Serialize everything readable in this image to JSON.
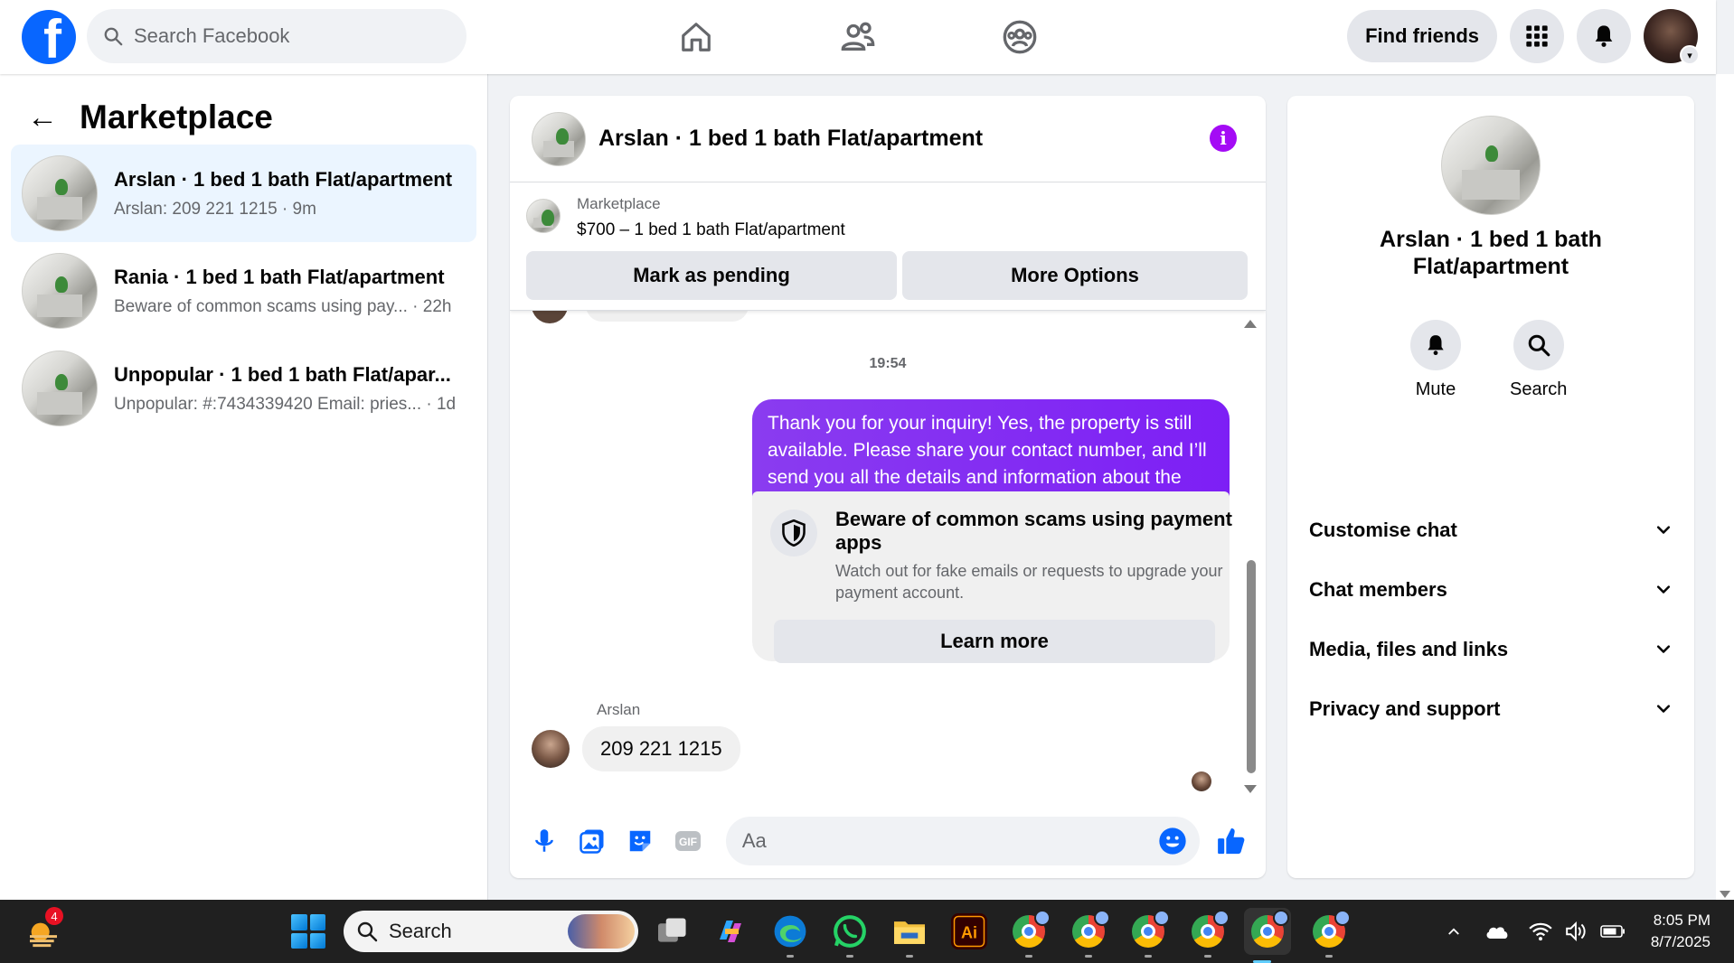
{
  "topbar": {
    "logo_letter": "f",
    "search_placeholder": "Search Facebook",
    "nav": [
      "home-icon",
      "friends-icon",
      "groups-icon"
    ],
    "find_friends": "Find friends"
  },
  "sidebar": {
    "back_arrow": "←",
    "title": "Marketplace",
    "conversations": [
      {
        "title": "Arslan · 1 bed 1 bath Flat/apartment",
        "subtitle": "Arslan: 209 221 1215 · 9m",
        "active": true
      },
      {
        "title": "Rania · 1 bed 1 bath Flat/apartment",
        "subtitle": "Beware of common scams using pay... · 22h",
        "active": false
      },
      {
        "title": "Unpopular · 1 bed 1 bath Flat/apar...",
        "subtitle": "Unpopular: #:7434339420 Email: pries... · 1d",
        "active": false
      }
    ]
  },
  "chat": {
    "title": "Arslan · 1 bed 1 bath Flat/apartment",
    "info_glyph": "i",
    "listing": {
      "category": "Marketplace",
      "price_title": "$700 – 1 bed 1 bath Flat/apartment",
      "mark_pending": "Mark as pending",
      "more_options": "More Options"
    },
    "timestamp": "19:54",
    "sent_message": "Thank you for your inquiry! Yes, the property is still available. Please share your contact number, and I’ll send you all the details and information about the home.",
    "warning": {
      "title": "Beware of common scams using payment apps",
      "body": "Watch out for fake emails or requests to upgrade your payment account.",
      "button": "Learn more"
    },
    "sender_name": "Arslan",
    "received_message": "209 221 1215",
    "composer_placeholder": "Aa"
  },
  "info_panel": {
    "title": "Arslan · 1 bed 1 bath Flat/apartment",
    "actions": [
      {
        "label": "Mute",
        "icon": "bell-icon"
      },
      {
        "label": "Search",
        "icon": "search-icon"
      }
    ],
    "sections": [
      "Customise chat",
      "Chat members",
      "Media, files and links",
      "Privacy and support"
    ]
  },
  "taskbar": {
    "widget_badge": "4",
    "search_label": "Search",
    "clock_time": "8:05 PM",
    "clock_date": "8/7/2025"
  },
  "colors": {
    "brand": "#0866ff",
    "sent_bubble": "#7d1ff5",
    "info_accent": "#a40bf5",
    "active_row": "#ebf5ff"
  }
}
